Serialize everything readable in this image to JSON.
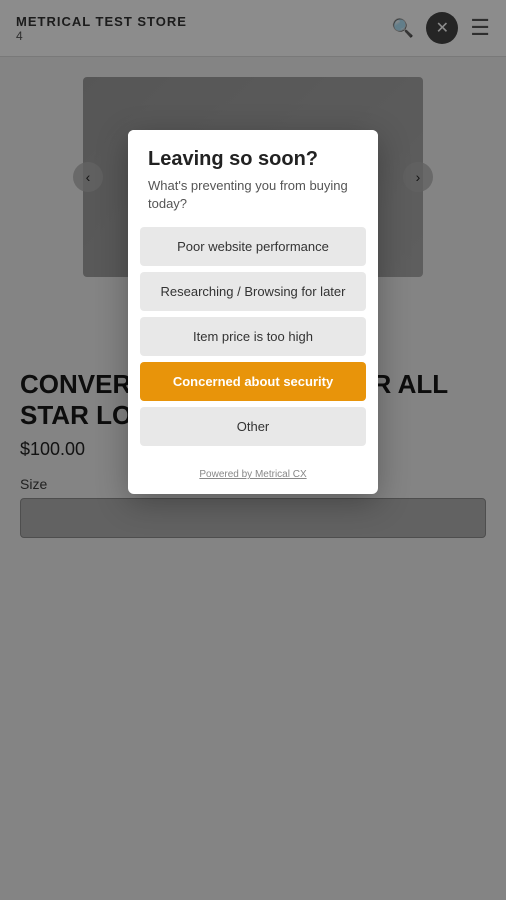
{
  "store": {
    "name": "METRICAL TEST STORE",
    "number": "4"
  },
  "modal": {
    "title": "Leaving so soon?",
    "subtitle": "What's preventing you from buying today?",
    "options": [
      {
        "id": "poor-perf",
        "label": "Poor website performance",
        "active": false
      },
      {
        "id": "researching",
        "label": "Researching / Browsing for later",
        "active": false
      },
      {
        "id": "price-high",
        "label": "Item price is too high",
        "active": false
      },
      {
        "id": "security",
        "label": "Concerned about security",
        "active": true
      },
      {
        "id": "other",
        "label": "Other",
        "active": false
      }
    ],
    "footer": "Powered by Metrical CX"
  },
  "product": {
    "name": "CONVERSE | CHUCK TAYLOR ALL STAR LO",
    "price": "$100.00",
    "size_label": "Size"
  },
  "icons": {
    "search": "🔍",
    "close": "✕",
    "menu": "☰",
    "arrow_left": "‹",
    "arrow_right": "›"
  }
}
